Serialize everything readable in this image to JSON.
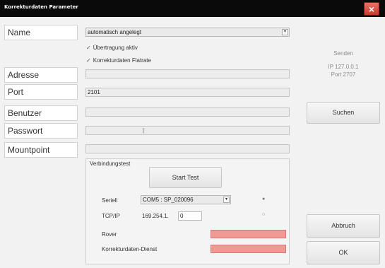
{
  "window": {
    "title": "Korrekturdaten Parameter",
    "close_glyph": "×"
  },
  "fields": {
    "name": {
      "label": "Name",
      "value": "automatisch angelegt"
    },
    "checkbox_transfer": {
      "label": "Übertragung aktiv",
      "checked": true
    },
    "checkbox_flatrate": {
      "label": "Korrekturdaten Flatrate",
      "checked": true
    },
    "adresse": {
      "label": "Adresse",
      "value": ""
    },
    "port": {
      "label": "Port",
      "value": "2101"
    },
    "benutzer": {
      "label": "Benutzer",
      "value": ""
    },
    "passwort": {
      "label": "Passwort",
      "value": ""
    },
    "mountpoint": {
      "label": "Mountpoint",
      "value": ""
    }
  },
  "side": {
    "senden": "Senden",
    "ip": "IP 127.0.0.1",
    "port": "Port 2707",
    "suchen": "Suchen",
    "abbruch": "Abbruch",
    "ok": "OK"
  },
  "verbindungstest": {
    "title": "Verbindungstest",
    "start_test": "Start Test",
    "seriell_label": "Seriell",
    "seriell_value": "COM5 : SP_020096",
    "seriell_selected": true,
    "tcpip_label": "TCP/IP",
    "tcpip_prefix": "169.254.1.",
    "tcpip_value": "0",
    "tcpip_selected": false,
    "rover_label": "Rover",
    "dienst_label": "Korrekturdaten-Dienst",
    "status_color": "#f09a95"
  },
  "icons": {
    "check_mark": "✓",
    "dropdown": "▾",
    "radio_on": "●",
    "radio_off": "○",
    "cursor": "|"
  }
}
